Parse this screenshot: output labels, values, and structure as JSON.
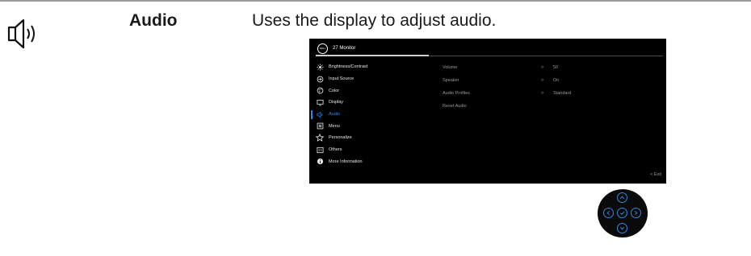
{
  "section": {
    "heading": "Audio",
    "description": "Uses the display to adjust audio."
  },
  "osd": {
    "logo_text": "DELL",
    "title": "27 Monitor",
    "menu": [
      {
        "label": "Brightness/Contrast",
        "icon": "brightness-icon"
      },
      {
        "label": "Input Source",
        "icon": "input-source-icon"
      },
      {
        "label": "Color",
        "icon": "color-icon"
      },
      {
        "label": "Display",
        "icon": "display-icon"
      },
      {
        "label": "Audio",
        "icon": "audio-icon",
        "active": true
      },
      {
        "label": "Menu",
        "icon": "menu-icon"
      },
      {
        "label": "Personalize",
        "icon": "star-icon"
      },
      {
        "label": "Others",
        "icon": "others-icon"
      },
      {
        "label": "More Information",
        "icon": "info-icon"
      }
    ],
    "submenu": [
      {
        "label": "Volume",
        "arrow": ">",
        "value": "50"
      },
      {
        "label": "Speaker",
        "arrow": ">",
        "value": "On"
      },
      {
        "label": "Audio Profiles",
        "arrow": ">",
        "value": "Standard"
      },
      {
        "label": "Reset Audio",
        "arrow": "",
        "value": ""
      }
    ],
    "exit_label": "< Exit"
  },
  "colors": {
    "accent": "#2f8ae0",
    "osd_background": "#000000"
  }
}
